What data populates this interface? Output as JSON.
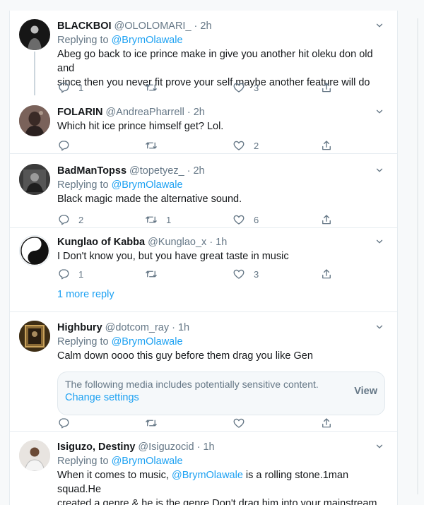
{
  "tweets": [
    {
      "name": "BLACKBOI",
      "handle": "@OLOLOMARI_",
      "time": "· 2h",
      "replying_prefix": "Replying to ",
      "replying_to": "@BrymOlawale",
      "text_lines": [
        "Abeg go back to ice prince make in give you another hit oleku don old and",
        "since then you never fit prove your self maybe another feature will do"
      ],
      "replies": "1",
      "retweets": "",
      "likes": "3"
    },
    {
      "name": "FOLARIN",
      "handle": "@AndreaPharrell",
      "time": "· 2h",
      "text": "Which hit ice prince himself get? Lol.",
      "replies": "",
      "retweets": "",
      "likes": "2"
    },
    {
      "name": "BadManTopss",
      "handle": "@topetyez_",
      "time": "· 2h",
      "replying_prefix": "Replying to ",
      "replying_to": "@BrymOlawale",
      "text": "Black magic made the alternative sound.",
      "replies": "2",
      "retweets": "1",
      "likes": "6"
    },
    {
      "name": "Kunglao of Kabba",
      "handle": "@Kunglao_x",
      "time": "· 1h",
      "text": "I Don't know you, but you have great taste in music",
      "replies": "1",
      "retweets": "",
      "likes": "3"
    },
    {
      "name": "Highbury",
      "handle": "@dotcom_ray",
      "time": "· 1h",
      "replying_prefix": "Replying to ",
      "replying_to": "@BrymOlawale",
      "text": "Calm down oooo this guy before them drag you like Gen",
      "replies": "",
      "retweets": "",
      "likes": ""
    },
    {
      "name": "Isiguzo, Destiny",
      "handle": "@Isiguzocid",
      "time": "· 1h",
      "replying_prefix": "Replying to ",
      "replying_to": "@BrymOlawale",
      "text_a": "When it comes to music, ",
      "text_mention": "@BrymOlawale",
      "text_b": " is a rolling stone.1man squad.He",
      "text_line2": "created a genre & he is the genre.Don't drag him into your mainstream he"
    }
  ],
  "more_reply": "1 more reply",
  "media_warning": {
    "message": "The following media includes potentially sensitive content.",
    "change": "Change settings",
    "view": "View"
  }
}
